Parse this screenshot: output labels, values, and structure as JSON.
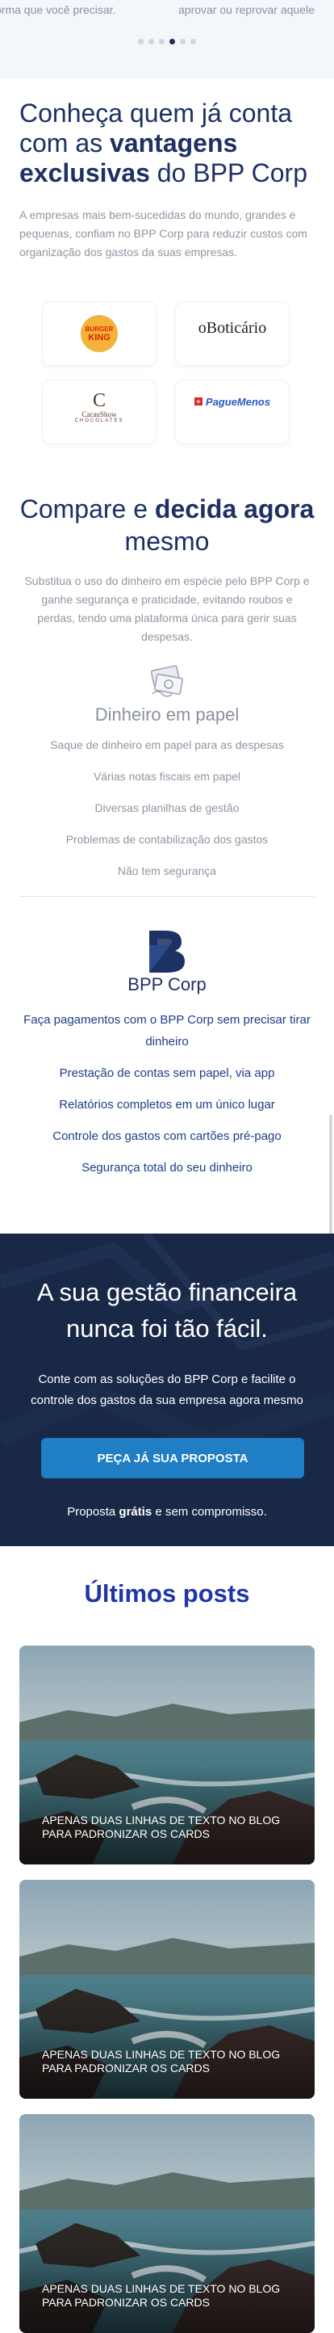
{
  "carousel": {
    "left_text": "orma que você precisar.",
    "right_text": "aprovar ou reprovar aquele",
    "dots": 6,
    "active_dot": 4
  },
  "vantagens": {
    "title_pre": "Conheça quem já conta com as ",
    "title_bold": "vantagens exclusivas",
    "title_post": " do BPP Corp",
    "description": "A empresas mais bem-sucedidas do mundo, grandes e pequenas, confiam no BPP Corp para reduzir custos com organização dos gastos da suas empresas.",
    "logos": {
      "burger_king_top": "BURGER",
      "burger_king_bottom": "KING",
      "boticario": "oBoticário",
      "cacau_mark": "C",
      "cacau_name": "CacauShow",
      "cacau_sub": "CHOCOLATES",
      "pague_menos": "PagueMenos"
    }
  },
  "compare": {
    "title_pre": "Compare e ",
    "title_bold": "decida agora",
    "title_post": " mesmo",
    "description": "Substitua o uso do dinheiro em espécie pelo BPP Corp e ganhe segurança e praticidade, evitando roubos e perdas, tendo uma plataforma única para gerir suas despesas.",
    "paper_title": "Dinheiro em papel",
    "paper_items": [
      "Saque de dinheiro em papel para as despesas",
      "Várias notas fiscais em papel",
      "Diversas planilhas de gestão",
      "Problemas de contabilização dos gastos",
      "Não tem segurança"
    ],
    "bpp_name": "BPP Corp",
    "bpp_items": [
      "Faça pagamentos com o BPP Corp sem precisar tirar dinheiro",
      "Prestação de contas sem papel, via app",
      "Relatórios completos em um único lugar",
      "Controle dos gastos com cartões pré-pago",
      "Segurança total do seu dinheiro"
    ]
  },
  "banner": {
    "title": "A sua gestão financeira nunca foi tão fácil.",
    "description": "Conte com as soluções do BPP Corp e facilite o controle dos gastos da sua empresa agora mesmo",
    "cta_label": "PEÇA JÁ SUA PROPOSTA",
    "note_pre": "Proposta ",
    "note_bold": "grátis",
    "note_post": " e sem compromisso."
  },
  "posts": {
    "title": "Últimos posts",
    "items": [
      {
        "title": "APENAS DUAS LINHAS DE TEXTO NO BLOG PARA PADRONIZAR OS CARDS"
      },
      {
        "title": "APENAS DUAS LINHAS DE TEXTO NO BLOG PARA PADRONIZAR OS CARDS"
      },
      {
        "title": "APENAS DUAS LINHAS DE TEXTO NO BLOG PARA PADRONIZAR OS CARDS"
      }
    ]
  },
  "colors": {
    "navy": "#1e3163",
    "link_blue": "#1e3c86",
    "cta_blue": "#1f7ec4",
    "posts_title": "#1f36a8",
    "muted_text": "#8f96a2"
  }
}
